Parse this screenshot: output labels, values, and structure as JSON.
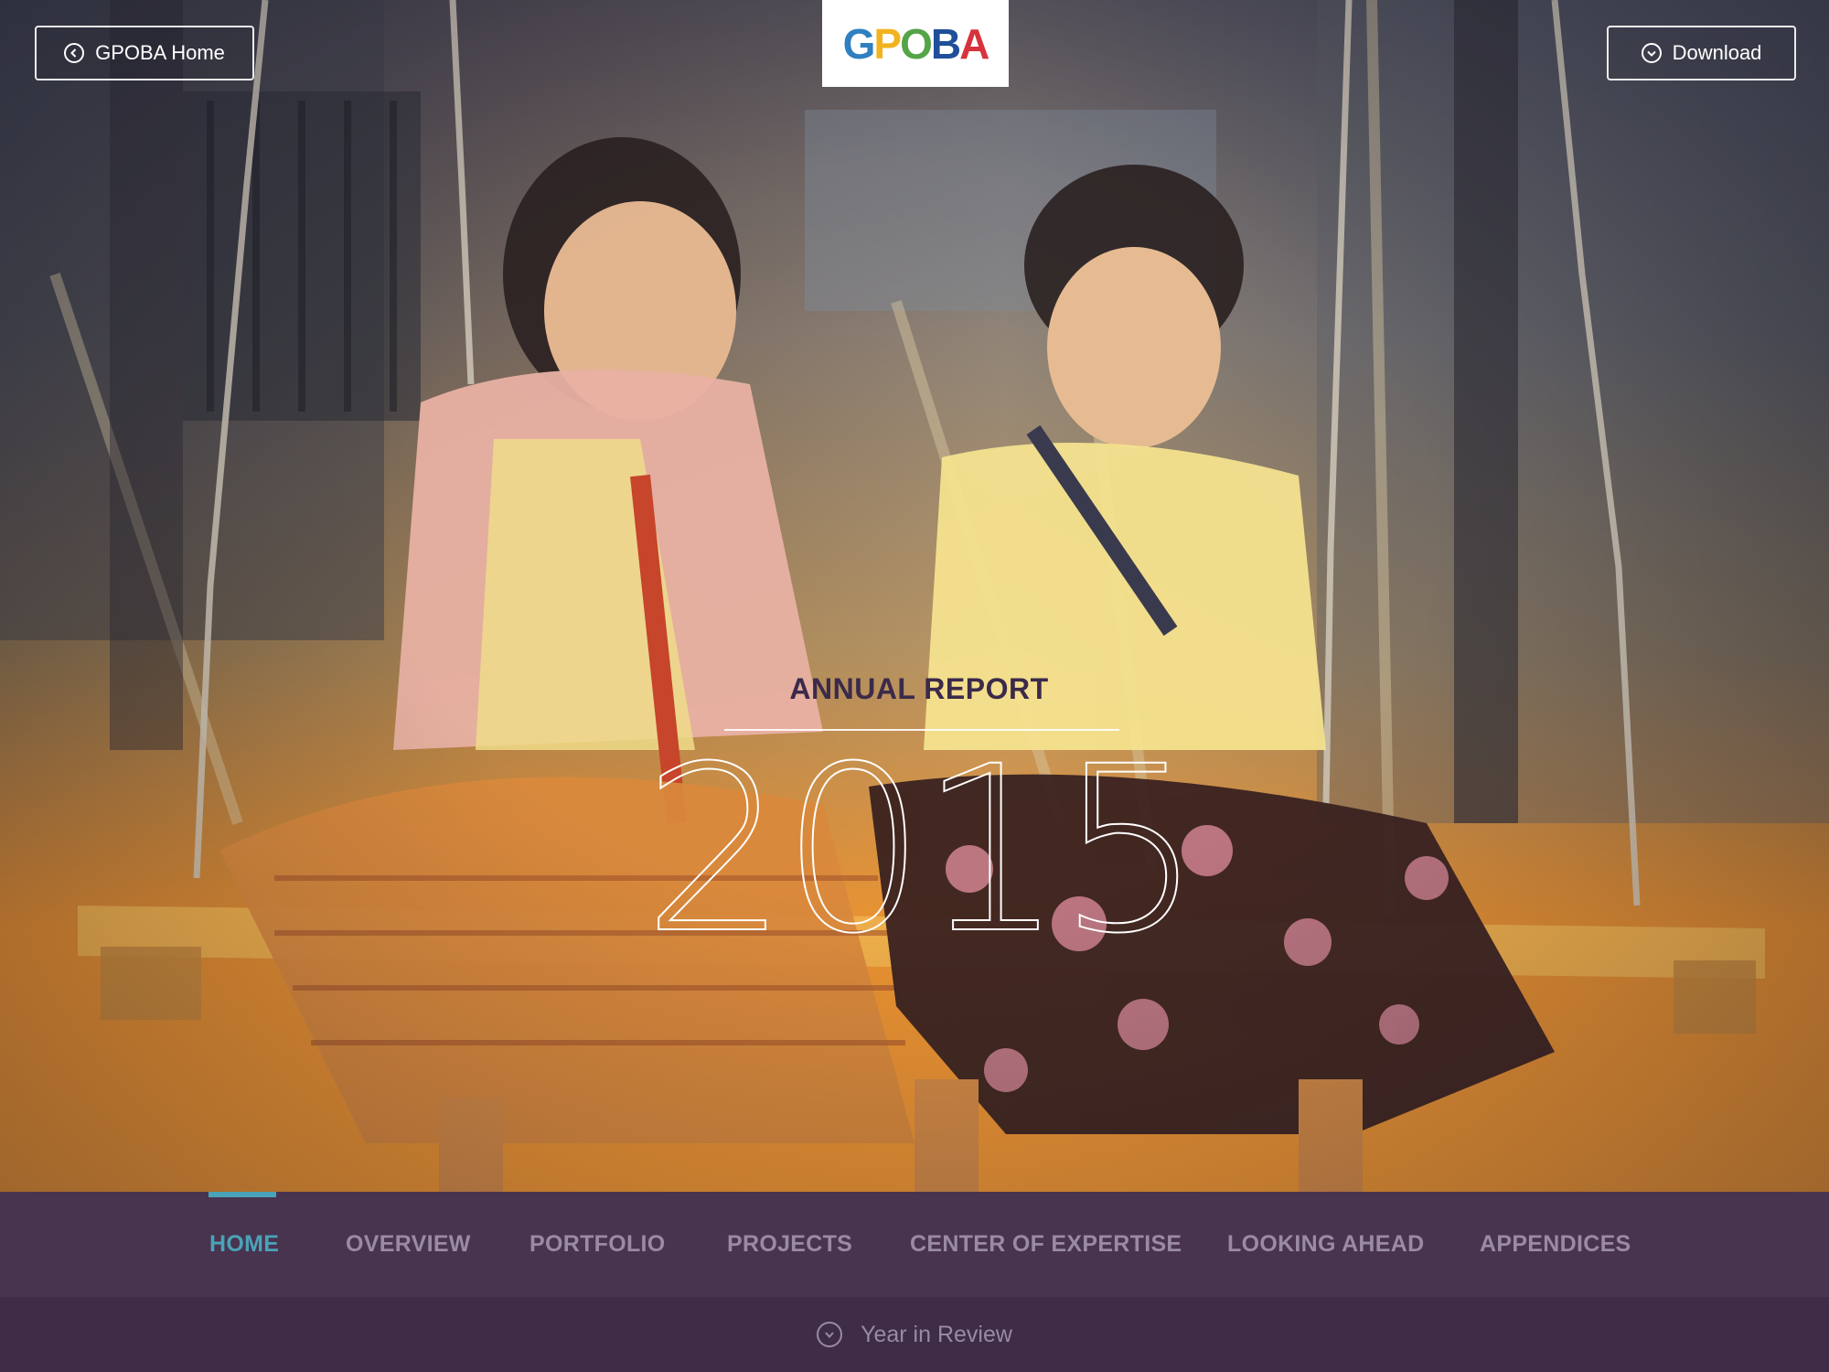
{
  "header": {
    "home_button": "GPOBA Home",
    "download_button": "Download",
    "logo": {
      "letters": [
        "G",
        "P",
        "O",
        "B",
        "A"
      ],
      "colors": [
        "#2f7fc1",
        "#f2b320",
        "#55a448",
        "#1f4f9a",
        "#d6333d"
      ]
    }
  },
  "hero": {
    "subtitle": "ANNUAL REPORT",
    "year": "2015"
  },
  "nav": {
    "items": [
      {
        "label": "HOME",
        "active": true
      },
      {
        "label": "OVERVIEW",
        "active": false
      },
      {
        "label": "PORTFOLIO",
        "active": false
      },
      {
        "label": "PROJECTS",
        "active": false
      },
      {
        "label": "CENTER OF EXPERTISE",
        "active": false
      },
      {
        "label": "LOOKING AHEAD",
        "active": false
      },
      {
        "label": "APPENDICES",
        "active": false
      }
    ]
  },
  "footer": {
    "next_section": "Year in Review"
  },
  "icons": {
    "home": "chevron-left-circle-icon",
    "download": "chevron-down-circle-icon",
    "next": "chevron-down-circle-icon"
  },
  "colors": {
    "nav_bg": "#48344f",
    "footer_bg": "#3f2c46",
    "accent": "#4aa3b8",
    "nav_text": "#9a8aa3",
    "hero_tint": "#f39a30"
  }
}
